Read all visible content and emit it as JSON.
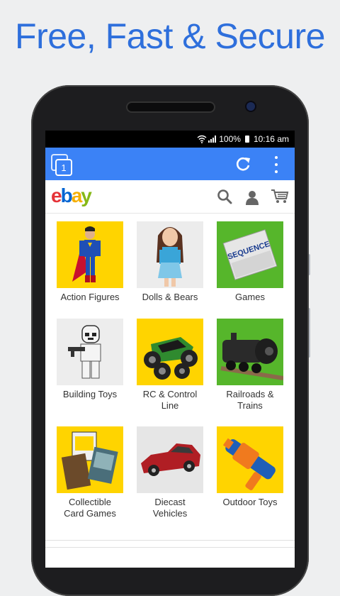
{
  "promo": {
    "headline": "Free, Fast & Secure"
  },
  "status_bar": {
    "battery": "100%",
    "time": "10:16 am"
  },
  "browser": {
    "tab_count": "1",
    "icons": {
      "tabs": "tabs-icon",
      "reload": "reload-icon",
      "menu": "overflow-menu-icon"
    }
  },
  "site": {
    "logo_letters": [
      "e",
      "b",
      "a",
      "y"
    ],
    "header_icons": [
      "search-icon",
      "account-icon",
      "cart-icon"
    ]
  },
  "categories": [
    {
      "label": "Action Figures"
    },
    {
      "label": "Dolls & Bears"
    },
    {
      "label": "Games"
    },
    {
      "label": "Building Toys"
    },
    {
      "label": "RC & Control\nLine"
    },
    {
      "label": "Railroads &\nTrains"
    },
    {
      "label": "Collectible\nCard Games"
    },
    {
      "label": "Diecast\nVehicles"
    },
    {
      "label": "Outdoor Toys"
    }
  ],
  "image_text": {
    "game_box": "SEQUENCE"
  },
  "colors": {
    "accent": "#3b82f6",
    "headline": "#2e6fdc",
    "tile_yellow": "#ffd400",
    "tile_green": "#56b62b"
  }
}
